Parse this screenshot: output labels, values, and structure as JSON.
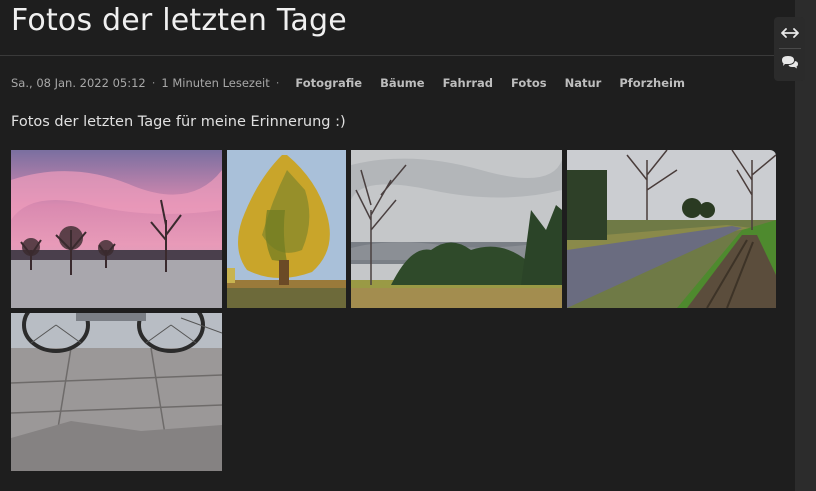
{
  "post": {
    "title": "Fotos der letzten Tage",
    "date": "Sa., 08 Jan. 2022 05:12",
    "separator": "·",
    "reading_time": "1 Minuten Lesezeit",
    "tags": [
      "Fotografie",
      "Bäume",
      "Fahrrad",
      "Fotos",
      "Natur",
      "Pforzheim"
    ],
    "intro": "Fotos der letzten Tage für meine Erinnerung :)"
  },
  "gallery": {
    "photos": [
      {
        "subject": "orchard-sunset"
      },
      {
        "subject": "sequoia-tree"
      },
      {
        "subject": "valley-view"
      },
      {
        "subject": "cycle-path"
      },
      {
        "subject": "bicycle-pavement"
      }
    ]
  },
  "tools": {
    "width_toggle_icon": "arrows-left-right-icon",
    "comments_icon": "comments-icon"
  }
}
